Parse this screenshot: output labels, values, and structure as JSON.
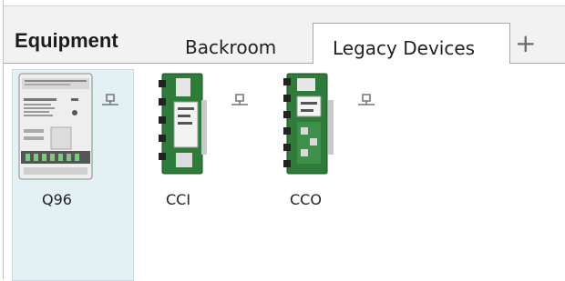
{
  "header": {
    "title": "Equipment",
    "tabs": [
      {
        "label": "Backroom",
        "active": false
      },
      {
        "label": "Legacy Devices",
        "active": true
      }
    ],
    "add_tab_label": "+"
  },
  "devices": [
    {
      "label": "Q96",
      "selected": true,
      "icon": "q96-module-icon",
      "status_icon": "link-icon"
    },
    {
      "label": "CCI",
      "selected": false,
      "icon": "cci-board-icon",
      "status_icon": "link-icon"
    },
    {
      "label": "CCO",
      "selected": false,
      "icon": "cco-board-icon",
      "status_icon": "link-icon"
    }
  ],
  "colors": {
    "selection": "#e4f1f4",
    "tab_strip": "#f2f2f2",
    "board_green": "#2e7b3a"
  }
}
